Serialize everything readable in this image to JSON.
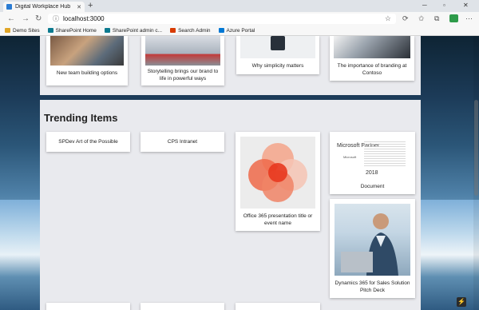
{
  "browser": {
    "tab_title": "Digital Workplace Hub",
    "url": "localhost:3000",
    "favorites": [
      {
        "label": "Demo Sites",
        "color": "#e0a526"
      },
      {
        "label": "SharePoint Home",
        "color": "#0b7a8f"
      },
      {
        "label": "SharePoint admin c...",
        "color": "#0b7a8f"
      },
      {
        "label": "Search Admin",
        "color": "#d83b01"
      },
      {
        "label": "Azure Portal",
        "color": "#0078d4"
      }
    ]
  },
  "top_row": {
    "items": [
      {
        "title": "New team building options"
      },
      {
        "title": "Storytelling brings our brand to life in powerful ways"
      },
      {
        "title": "Why simplicity matters"
      },
      {
        "title": "The importance of branding at Contoso"
      }
    ]
  },
  "trending": {
    "heading": "Trending Items",
    "items": [
      {
        "title": "SPDev Art of the Possible"
      },
      {
        "title": "CPS Intranet"
      },
      {
        "title": "Office 365 presentation title or event name"
      },
      {
        "title": "Document",
        "thumb_brand": "Microsoft Partner",
        "thumb_sub": "Microsoft",
        "thumb_year": "2018"
      },
      {
        "title": "Dynamics 365 for Sales Solution Pitch Deck"
      }
    ]
  }
}
